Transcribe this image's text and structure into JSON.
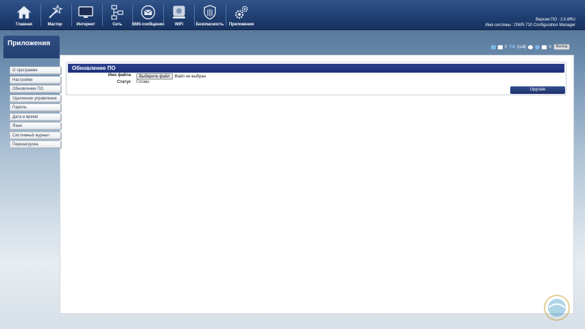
{
  "nav": {
    "items": [
      {
        "label": "Главная",
        "icon": "home-icon"
      },
      {
        "label": "Мастер",
        "icon": "wizard-icon"
      },
      {
        "label": "Интернет",
        "icon": "monitor-icon"
      },
      {
        "label": "Сеть",
        "icon": "network-icon"
      },
      {
        "label": "SMS-сообщения",
        "icon": "envelope-icon"
      },
      {
        "label": "WiFi",
        "icon": "wifi-router-icon"
      },
      {
        "label": "Безопасность",
        "icon": "shield-icon"
      },
      {
        "label": "Приложения",
        "icon": "gears-icon"
      }
    ]
  },
  "sysinfo": {
    "version_line": "Версия ПО : 2.0.8RU",
    "system_line": "Имя системы : DWR-710 Configuration Manager"
  },
  "section": {
    "title": "Приложения"
  },
  "status": {
    "sms_count": "0",
    "signal": "(null)",
    "msg_count": "0",
    "logout": "Выход"
  },
  "sidebar": {
    "items": [
      {
        "label": "О программе"
      },
      {
        "label": "Настройки"
      },
      {
        "label": "Обновление ПО"
      },
      {
        "label": "Удаленное управление"
      },
      {
        "label": "Пароль"
      },
      {
        "label": "Дата и время"
      },
      {
        "label": "Язык"
      },
      {
        "label": "Системный журнал"
      },
      {
        "label": "Перезагрузка"
      }
    ]
  },
  "firmware": {
    "title": "Обновление ПО",
    "file_label": "Имя файла",
    "file_button": "Выберите файл",
    "file_none": "Файл не выбран",
    "status_label": "Статус",
    "status_value": "Готово",
    "upgrade_button": "Upgrade"
  },
  "colors": {
    "nav_bg": "#1f3d70",
    "header_blue": "#1e2f78",
    "button_blue": "#1c2f6b"
  }
}
